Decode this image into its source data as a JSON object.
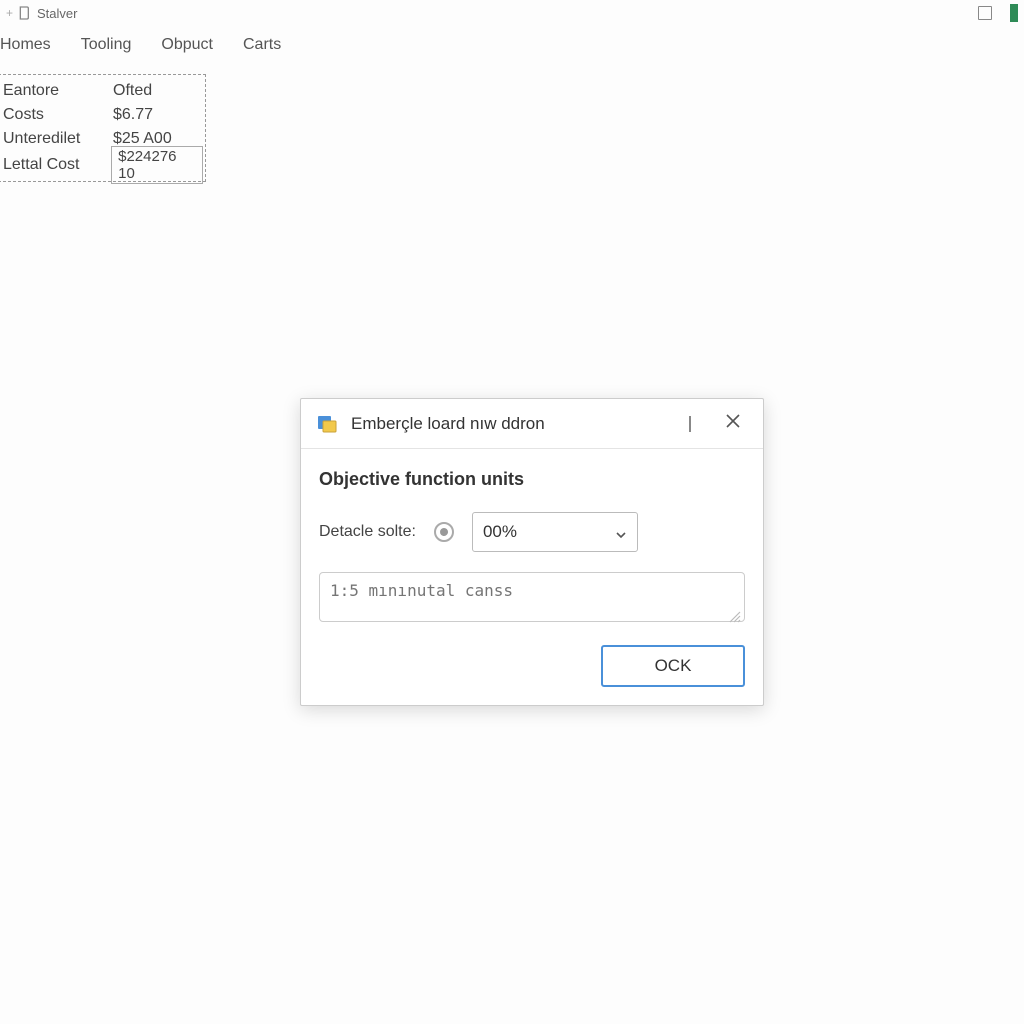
{
  "titlebar": {
    "app_name": "Stalver"
  },
  "tabs": {
    "items": [
      "Homes",
      "Tooling",
      "Obpuct",
      "Carts"
    ]
  },
  "summary": {
    "rows": [
      {
        "label": "Eantore",
        "value": "Ofted"
      },
      {
        "label": "Costs",
        "value": "$6.77"
      },
      {
        "label": "Unteredilet",
        "value": "$25 A00"
      }
    ],
    "total": {
      "label": "Lettal Cost",
      "value": "$224276 10"
    }
  },
  "modal": {
    "title": "Emberçle loard nıw ddron",
    "heading": "Objective function units",
    "field_label": "Detacle solte:",
    "select_value": "00%",
    "textarea_placeholder": "1:5 mınınutal canss",
    "ok_label": "OCK"
  }
}
